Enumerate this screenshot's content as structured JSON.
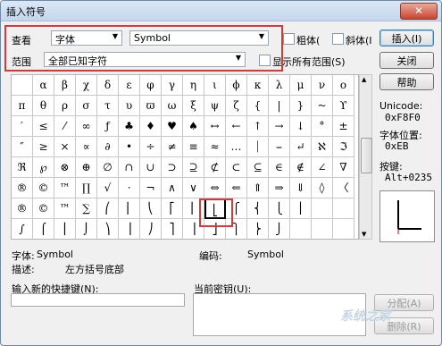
{
  "window": {
    "title": "插入符号",
    "close_label": "✕"
  },
  "filters": {
    "view_label": "查看",
    "type_value": "字体",
    "font_value": "Symbol",
    "range_label": "范围",
    "range_value": "全部已知字符",
    "bold_label": "粗体(",
    "italic_label": "斜体(I",
    "show_all_label": "显示所有范围(S)"
  },
  "buttons": {
    "insert": "插入(I)",
    "close": "关闭",
    "help": "帮助",
    "assign": "分配(A)",
    "remove": "删除(R)"
  },
  "info": {
    "unicode_label": "Unicode:",
    "unicode_value": "0xF8F0",
    "font_pos_label": "字体位置:",
    "font_pos_value": "0xEB",
    "key_label": "按键:",
    "key_value": "Alt+0235"
  },
  "details": {
    "font_label": "字体:",
    "font_value": "Symbol",
    "code_label": "编码:",
    "code_value": "Symbol",
    "desc_label": "描述:",
    "desc_value": "左方括号底部"
  },
  "shortcut": {
    "new_label": "输入新的快捷键(N):",
    "current_label": "当前密钥(U):"
  },
  "symbols": [
    [
      "",
      "α",
      "β",
      "χ",
      "δ",
      "ε",
      "φ",
      "γ",
      "η",
      "ι",
      "ϕ",
      "κ",
      "λ",
      "μ",
      "ν",
      "ο"
    ],
    [
      "π",
      "θ",
      "ρ",
      "σ",
      "τ",
      "υ",
      "ϖ",
      "ω",
      "ξ",
      "ψ",
      "ζ",
      "{",
      "|",
      "}",
      "~",
      "ϒ"
    ],
    [
      "′",
      "≤",
      "⁄",
      "∞",
      "ƒ",
      "♣",
      "♦",
      "♥",
      "♠",
      "↔",
      "←",
      "↑",
      "→",
      "↓",
      "°",
      "±"
    ],
    [
      "″",
      "≥",
      "×",
      "∝",
      "∂",
      "•",
      "÷",
      "≠",
      "≡",
      "≈",
      "…",
      "⏐",
      "⎯",
      "↵",
      "ℵ",
      "ℑ"
    ],
    [
      "ℜ",
      "℘",
      "⊗",
      "⊕",
      "∅",
      "∩",
      "∪",
      "⊃",
      "⊇",
      "⊄",
      "⊂",
      "⊆",
      "∈",
      "∉",
      "∠",
      "∇"
    ],
    [
      "®",
      "©",
      "™",
      "∏",
      "√",
      "⋅",
      "¬",
      "∧",
      "∨",
      "⇔",
      "⇐",
      "⇑",
      "⇒",
      "⇓",
      "◊",
      "〈"
    ],
    [
      "®",
      "©",
      "™",
      "∑",
      "⎛",
      "⎜",
      "⎝",
      "⎡",
      "⎢",
      "⎣",
      "⎧",
      "⎨",
      "⎩",
      "⎪",
      "",
      ""
    ],
    [
      "∫",
      "⌠",
      "⎮",
      "⌡",
      "⎞",
      "⎟",
      "⎠",
      "⎤",
      "⎥",
      "⎦",
      "⎫",
      "⎬",
      "⎭",
      "",
      "",
      ""
    ]
  ],
  "watermark": "系统之家"
}
